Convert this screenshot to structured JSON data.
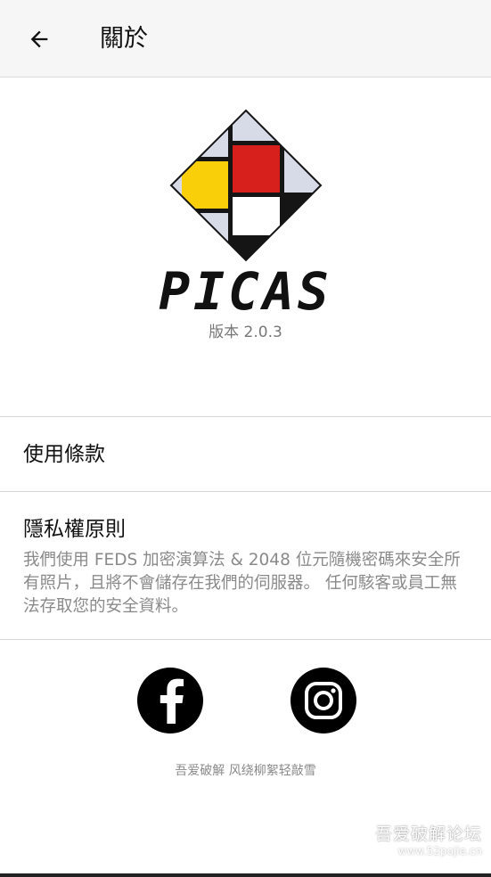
{
  "appbar": {
    "title": "關於",
    "back_icon": "arrow-left-icon"
  },
  "logo": {
    "icon": "picas-logo",
    "wordmark": "PICAS",
    "version": "版本 2.0.3"
  },
  "terms": {
    "label": "使用條款"
  },
  "privacy": {
    "title": "隱私權原則",
    "body": "我們使用 FEDS 加密演算法 & 2048 位元隨機密碼來安全所有照片，且將不會儲存在我們的伺服器。 任何駭客或員工無法存取您的安全資料。"
  },
  "social": {
    "facebook_icon": "facebook-icon",
    "instagram_icon": "instagram-icon"
  },
  "credit": "吾爱破解  风绕柳絮轻敲雪",
  "watermark": {
    "line1": "吾爱破解论坛",
    "line2": "www.52pojie.cn"
  },
  "colors": {
    "red": "#d7201b",
    "yellow": "#f9cf0a",
    "pale": "#d7dbe8",
    "black": "#111111"
  }
}
